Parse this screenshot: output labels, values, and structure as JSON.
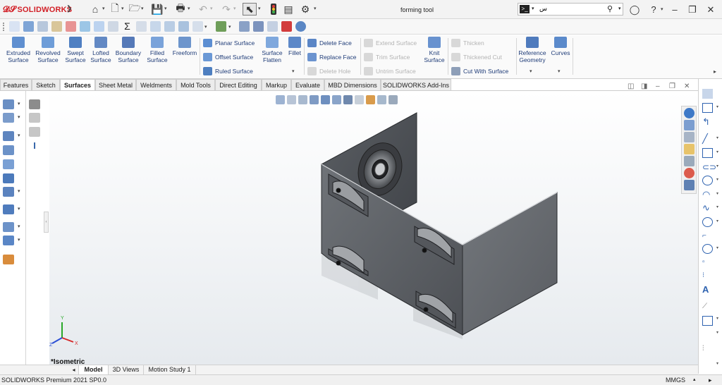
{
  "titlebar": {
    "app_name": "SOLIDWORKS",
    "document_title": "forming tool",
    "search_value": "س",
    "search_placeholder": ""
  },
  "ribbon": {
    "big_buttons": [
      {
        "line1": "Extruded",
        "line2": "Surface"
      },
      {
        "line1": "Revolved",
        "line2": "Surface"
      },
      {
        "line1": "Swept",
        "line2": "Surface"
      },
      {
        "line1": "Lofted",
        "line2": "Surface"
      },
      {
        "line1": "Boundary",
        "line2": "Surface"
      },
      {
        "line1": "Filled",
        "line2": "Surface"
      },
      {
        "line1": "Freeform",
        "line2": ""
      }
    ],
    "list_group_1": [
      "Planar Surface",
      "Offset Surface",
      "Ruled Surface"
    ],
    "surface_flatten": {
      "line1": "Surface",
      "line2": "Flatten"
    },
    "fillet": "Fillet",
    "list_group_2": [
      "Delete Face",
      "Replace Face",
      "Delete Hole"
    ],
    "list_group_3": [
      "Extend Surface",
      "Trim Surface",
      "Untrim Surface"
    ],
    "knit_surface": {
      "line1": "Knit",
      "line2": "Surface"
    },
    "list_group_4": [
      "Thicken",
      "Thickened Cut",
      "Cut With Surface"
    ],
    "reference_geometry": {
      "line1": "Reference",
      "line2": "Geometry"
    },
    "curves": "Curves"
  },
  "tabs": [
    "Features",
    "Sketch",
    "Surfaces",
    "Sheet Metal",
    "Weldments",
    "Mold Tools",
    "Direct Editing",
    "Markup",
    "Evaluate",
    "MBD Dimensions",
    "SOLIDWORKS Add-Ins"
  ],
  "active_tab": "Surfaces",
  "viewport": {
    "view_name": "*Isometric",
    "triad_x": "X",
    "triad_y": "Y",
    "triad_z": "Z"
  },
  "bottom_tabs": [
    "Model",
    "3D Views",
    "Motion Study 1"
  ],
  "status": {
    "product": "SOLIDWORKS Premium 2021 SP0.0",
    "units": "MMGS"
  },
  "colors": {
    "brand": "#d21f26",
    "ribbon_text": "#1f3c78",
    "part_face": "#6d7176",
    "part_face_dark": "#474a4f"
  }
}
